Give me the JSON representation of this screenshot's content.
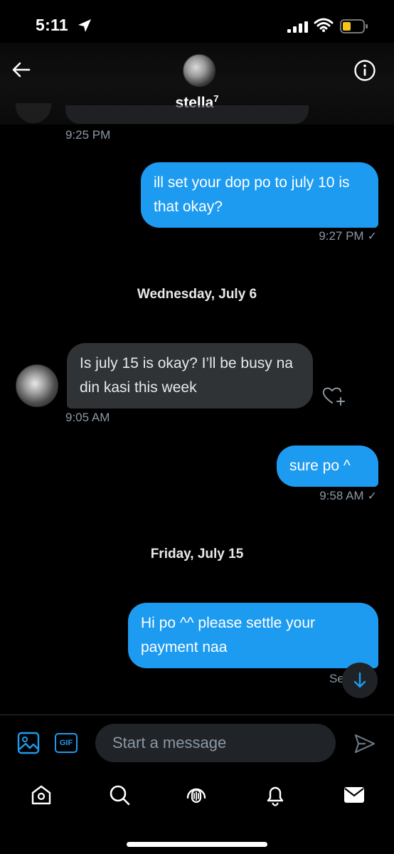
{
  "status_bar": {
    "time": "5:11",
    "icons": [
      "location-arrow-icon",
      "signal-icon",
      "wifi-icon",
      "battery-low-icon"
    ],
    "battery_color": "#f5c518"
  },
  "header": {
    "contact_name": "stella",
    "contact_superscript": "7",
    "back_icon": "back-arrow-icon",
    "info_icon": "info-icon"
  },
  "conversation": {
    "messages": [
      {
        "direction": "incoming",
        "text": "",
        "time": "9:25 PM"
      },
      {
        "direction": "outgoing",
        "text": "ill set your dop po to july 10 is that okay?",
        "time": "9:27 PM",
        "status": "✓"
      },
      {
        "date_separator": "Wednesday, July 6"
      },
      {
        "direction": "incoming",
        "text": "Is july 15 is okay? I’ll be busy na din kasi this week",
        "time": "9:05 AM",
        "reaction_icon": "heart-add-icon"
      },
      {
        "direction": "outgoing",
        "text": "sure po ^",
        "time": "9:58 AM",
        "status": "✓"
      },
      {
        "date_separator": "Friday, July 15"
      },
      {
        "direction": "outgoing",
        "text": "Hi po ^^ please settle your payment naa",
        "status_partial": "Se"
      }
    ]
  },
  "composer": {
    "image_icon": "image-icon",
    "gif_label": "GIF",
    "placeholder": "Start a message",
    "send_icon": "send-icon",
    "scroll_down_icon": "arrow-down-icon"
  },
  "tab_bar": {
    "items": [
      "home-icon",
      "search-icon",
      "spaces-icon",
      "notifications-icon",
      "messages-icon"
    ],
    "active": "messages-icon"
  },
  "colors": {
    "accent": "#1d9bf0",
    "incoming_bubble": "#2f3336",
    "secondary_text": "#8b98a5",
    "background": "#000000"
  }
}
